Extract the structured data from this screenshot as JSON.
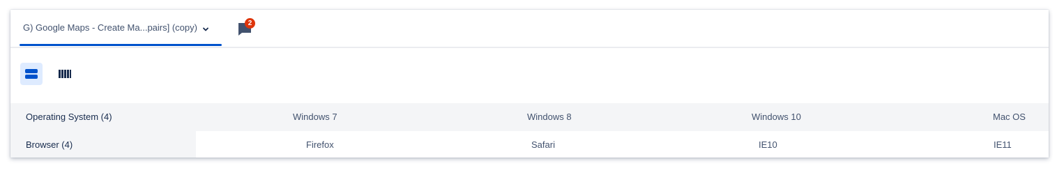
{
  "tab": {
    "label": "G) Google Maps - Create Ma...pairs] (copy)",
    "dropdown_icon": "chevron-down-icon"
  },
  "comments": {
    "icon": "comment-icon",
    "badge_count": "2",
    "badge_color": "#de350b"
  },
  "view_toggle": {
    "options": [
      {
        "icon": "rows-view-icon",
        "selected": true
      },
      {
        "icon": "columns-view-icon",
        "selected": false
      }
    ]
  },
  "matrix": {
    "rows": [
      {
        "label": "Operating System (4)",
        "values": [
          "Windows 7",
          "Windows 8",
          "Windows 10",
          "Mac OS"
        ]
      },
      {
        "label": "Browser (4)",
        "values": [
          "Firefox",
          "Safari",
          "IE10",
          "IE11"
        ]
      }
    ]
  },
  "colors": {
    "accent": "#0052cc",
    "selected_bg": "#deebff",
    "row_bg": "#f4f5f7"
  }
}
